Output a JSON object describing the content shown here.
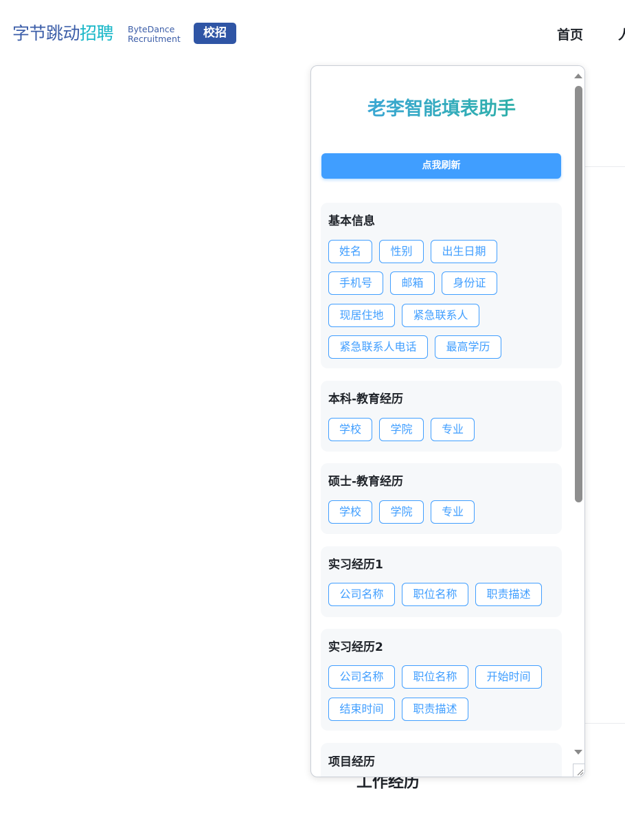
{
  "header": {
    "logo_cn_part1": "字节跳动",
    "logo_cn_part2": "招聘",
    "logo_en_line1": "ByteDance",
    "logo_en_line2": "Recruitment",
    "badge": "校招",
    "nav_home": "首页",
    "nav_next_partial": "人"
  },
  "background": {
    "section_heading_partial": "工作经历"
  },
  "panel": {
    "title": "老李智能填表助手",
    "refresh_label": "点我刷新",
    "sections": [
      {
        "title": "基本信息",
        "fields": [
          "姓名",
          "性别",
          "出生日期",
          "手机号",
          "邮箱",
          "身份证",
          "现居住地",
          "紧急联系人",
          "紧急联系人电话",
          "最高学历"
        ]
      },
      {
        "title": "本科-教育经历",
        "fields": [
          "学校",
          "学院",
          "专业"
        ]
      },
      {
        "title": "硕士-教育经历",
        "fields": [
          "学校",
          "学院",
          "专业"
        ]
      },
      {
        "title": "实习经历1",
        "fields": [
          "公司名称",
          "职位名称",
          "职责描述"
        ]
      },
      {
        "title": "实习经历2",
        "fields": [
          "公司名称",
          "职位名称",
          "开始时间",
          "结束时间",
          "职责描述"
        ]
      },
      {
        "title": "项目经历",
        "fields": []
      }
    ]
  },
  "colors": {
    "accent": "#409eff",
    "badge": "#2f55a5",
    "section_bg": "#f6f8fa",
    "title_gradient_start": "#3fa3e3",
    "title_gradient_end": "#2ab39a"
  }
}
